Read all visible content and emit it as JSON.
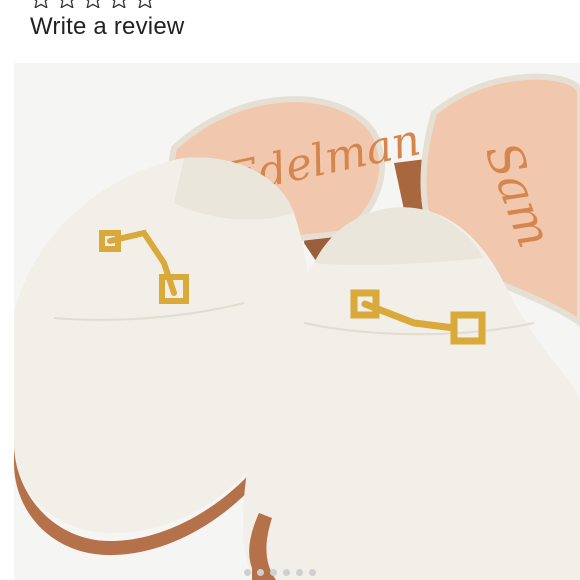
{
  "review": {
    "link_label": "Write a review",
    "rating_stars": 5
  },
  "product_image": {
    "insole_brand_text": "Sam Edelman",
    "shoe_color": "#f2efe8",
    "insole_color": "#f1c7ad",
    "hardware_color": "#d9a93a",
    "sole_color": "#b5714a",
    "background_color": "#f4f4f4"
  },
  "carousel": {
    "dot_count": 6
  }
}
